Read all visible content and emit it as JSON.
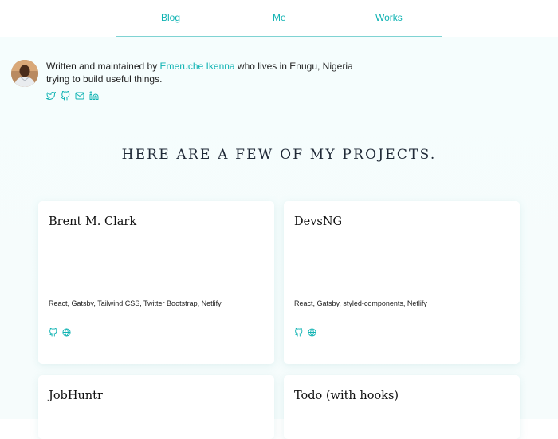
{
  "nav": {
    "links": [
      {
        "label": "Blog"
      },
      {
        "label": "Me"
      },
      {
        "label": "Works"
      }
    ]
  },
  "bio": {
    "prefix": "Written and maintained by ",
    "author": "Emeruche Ikenna",
    "suffix": " who lives in Enugu, Nigeria trying to build useful things.",
    "social": [
      "twitter-icon",
      "github-icon",
      "mail-icon",
      "linkedin-icon"
    ]
  },
  "projects": {
    "heading": "HERE ARE A FEW OF MY PROJECTS.",
    "items": [
      {
        "title": "Brent M. Clark",
        "tags": "React, Gatsby, Tailwind CSS, Twitter Bootstrap, Netlify"
      },
      {
        "title": "DevsNG",
        "tags": "React, Gatsby, styled-components, Netlify"
      },
      {
        "title": "JobHuntr",
        "tags": ""
      },
      {
        "title": "Todo (with hooks)",
        "tags": ""
      }
    ]
  },
  "colors": {
    "accent": "#10b3b3",
    "background": "#f5fdfd",
    "card": "#ffffff",
    "text": "#1f2937"
  }
}
